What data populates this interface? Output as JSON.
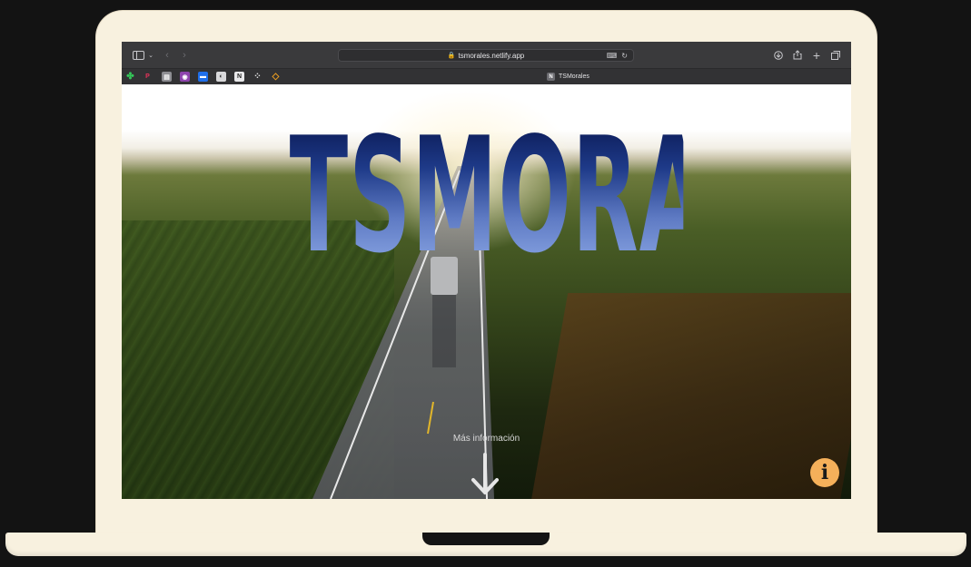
{
  "browser": {
    "url": "tsmorales.netlify.app",
    "tab_title": "TSMorales",
    "tab_favicon_letter": "N",
    "icons": {
      "sidebar": "sidebar-icon",
      "back": "chevron-left-icon",
      "forward": "chevron-right-icon",
      "downloads": "download-icon",
      "share": "share-icon",
      "new_tab": "plus-icon",
      "tabs": "tab-overview-icon"
    },
    "bookmarks": [
      {
        "name": "clover-app",
        "glyph": "✤",
        "color": "#34c759"
      },
      {
        "name": "p-app",
        "glyph": "P",
        "color": "#e8325a"
      },
      {
        "name": "notes-app",
        "glyph": "▤",
        "color": "#8e8e93"
      },
      {
        "name": "purple-app",
        "glyph": "◉",
        "color": "#8e44ad"
      },
      {
        "name": "blue-app",
        "glyph": "▬",
        "color": "#1f6feb"
      },
      {
        "name": "github",
        "glyph": "◐",
        "color": "#6e6e73"
      },
      {
        "name": "vercel",
        "glyph": "N",
        "color": "#d8d8da"
      },
      {
        "name": "dots-app",
        "glyph": "⁘",
        "color": "#3a3a3c"
      },
      {
        "name": "diamond-app",
        "glyph": "◇",
        "color": "#f0a020"
      }
    ]
  },
  "hero": {
    "title": "TSMORALES",
    "more_info": "Más información"
  },
  "colors": {
    "laptop_body": "#f8f1df",
    "background": "#131313",
    "info_button": "#f5b05a"
  }
}
